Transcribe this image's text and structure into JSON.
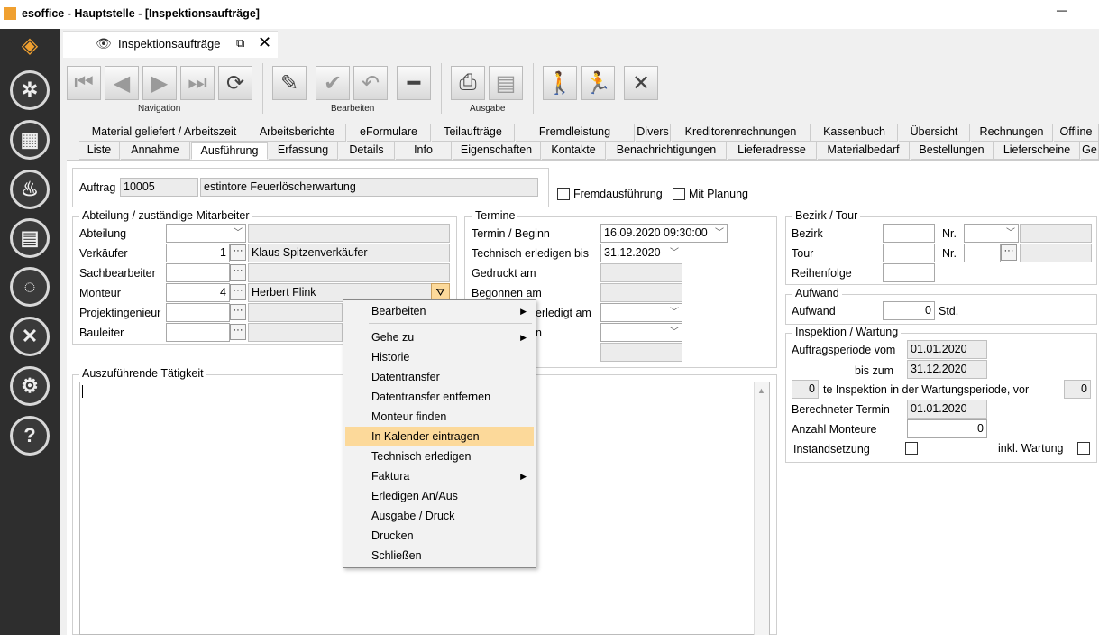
{
  "window": {
    "title": "esoffice - Hauptstelle - [Inspektionsaufträge]",
    "minimize": "─"
  },
  "sidebar": {
    "logo_icon": "esoffice-logo-icon",
    "items": [
      {
        "name": "steering-wheel-icon",
        "glyph": "✲"
      },
      {
        "name": "planning-board-icon",
        "glyph": "▦"
      },
      {
        "name": "alarm-light-icon",
        "glyph": "♨"
      },
      {
        "name": "cash-icon",
        "glyph": "▤"
      },
      {
        "name": "headset-icon",
        "glyph": "◌"
      },
      {
        "name": "tools-icon",
        "glyph": "✕"
      },
      {
        "name": "settings-gears-icon",
        "glyph": "⚙"
      },
      {
        "name": "help-icon",
        "glyph": "?"
      }
    ]
  },
  "doc_tab": {
    "label": "Inspektionsaufträge",
    "close": "✕",
    "popout": "⧉",
    "view": "👁"
  },
  "toolbar": {
    "nav": {
      "first": "⏮",
      "prev": "◀",
      "next": "▶",
      "last": "⏭",
      "refresh": "⟳",
      "caption": "Navigation"
    },
    "edit": {
      "edit": "✎",
      "save": "✔",
      "undo": "↶",
      "delete": "━",
      "caption": "Bearbeiten"
    },
    "output": {
      "print": "⎙",
      "export": "▤",
      "caption": "Ausgabe"
    },
    "actions": {
      "walk": "🚶",
      "run": "🏃",
      "cancel": "✕"
    }
  },
  "tabs_row1": [
    "Material geliefert / Arbeitszeit",
    "Arbeitsberichte",
    "eFormulare",
    "Teilaufträge",
    "Fremdleistung",
    "Divers",
    "Kreditorenrechnungen",
    "Kassenbuch",
    "Übersicht",
    "Rechnungen",
    "Offline"
  ],
  "tabs_row2": [
    "Liste",
    "Annahme",
    "Ausführung",
    "Erfassung",
    "Details",
    "Info",
    "Eigenschaften",
    "Kontakte",
    "Benachrichtigungen",
    "Lieferadresse",
    "Materialbedarf",
    "Bestellungen",
    "Lieferscheine",
    "Ge"
  ],
  "auftrag": {
    "label": "Auftrag",
    "number": "10005",
    "description": "estintore Feuerlöscherwartung"
  },
  "checks": {
    "fremd": "Fremdausführung",
    "planung": "Mit Planung"
  },
  "abteilung": {
    "title": "Abteilung / zuständige Mitarbeiter",
    "abteilung_label": "Abteilung",
    "verkaeufer_label": "Verkäufer",
    "verkaeufer_nr": "1",
    "verkaeufer_name": "Klaus Spitzenverkäufer",
    "sachbearbeiter_label": "Sachbearbeiter",
    "monteur_label": "Monteur",
    "monteur_nr": "4",
    "monteur_name": "Herbert Flink",
    "projekting_label": "Projektingenieur",
    "bauleiter_label": "Bauleiter"
  },
  "termine": {
    "title": "Termine",
    "beginn_label": "Termin / Beginn",
    "beginn_value": "16.09.2020 09:30:00",
    "techn_label": "Technisch erledigen bis",
    "techn_value": "31.12.2020",
    "gedruckt_label": "Gedruckt am",
    "begonnen_label": "Begonnen am",
    "erledigt_label": "erledigt am",
    "row6_label": "n"
  },
  "bezirk": {
    "title": "Bezirk / Tour",
    "bezirk_label": "Bezirk",
    "nr_label": "Nr.",
    "tour_label": "Tour",
    "nr2_label": "Nr.",
    "reihenfolge_label": "Reihenfolge"
  },
  "aufwand": {
    "title": "Aufwand",
    "label": "Aufwand",
    "value": "0",
    "unit": "Std."
  },
  "inspektion": {
    "title": "Inspektion / Wartung",
    "periode_vom_label": "Auftragsperiode vom",
    "periode_vom": "01.01.2020",
    "bis_label": "bis zum",
    "bis": "31.12.2020",
    "nth_value": "0",
    "nth_label": "te Inspektion in der Wartungsperiode, vor",
    "nth_total": "0",
    "berechnet_label": "Berechneter Termin",
    "berechnet": "01.01.2020",
    "anzahl_label": "Anzahl Monteure",
    "anzahl": "0",
    "instand_label": "Instandsetzung",
    "wartung_label": "inkl. Wartung"
  },
  "taetigkeit": {
    "title": "Auszuführende Tätigkeit"
  },
  "context_menu": [
    {
      "label": "Bearbeiten",
      "sub": true
    },
    {
      "label": "Gehe zu",
      "sub": true
    },
    {
      "label": "Historie"
    },
    {
      "label": "Datentransfer"
    },
    {
      "label": "Datentransfer entfernen"
    },
    {
      "label": "Monteur finden"
    },
    {
      "label": "In Kalender eintragen",
      "highlight": true
    },
    {
      "label": "Technisch erledigen"
    },
    {
      "label": "Faktura",
      "sub": true
    },
    {
      "label": "Erledigen An/Aus"
    },
    {
      "label": "Ausgabe / Druck"
    },
    {
      "label": "Drucken"
    },
    {
      "label": "Schließen"
    }
  ],
  "colors": {
    "sidebar": "#2e2e2e",
    "highlight": "#fcd99a",
    "accent": "#f0a030"
  }
}
